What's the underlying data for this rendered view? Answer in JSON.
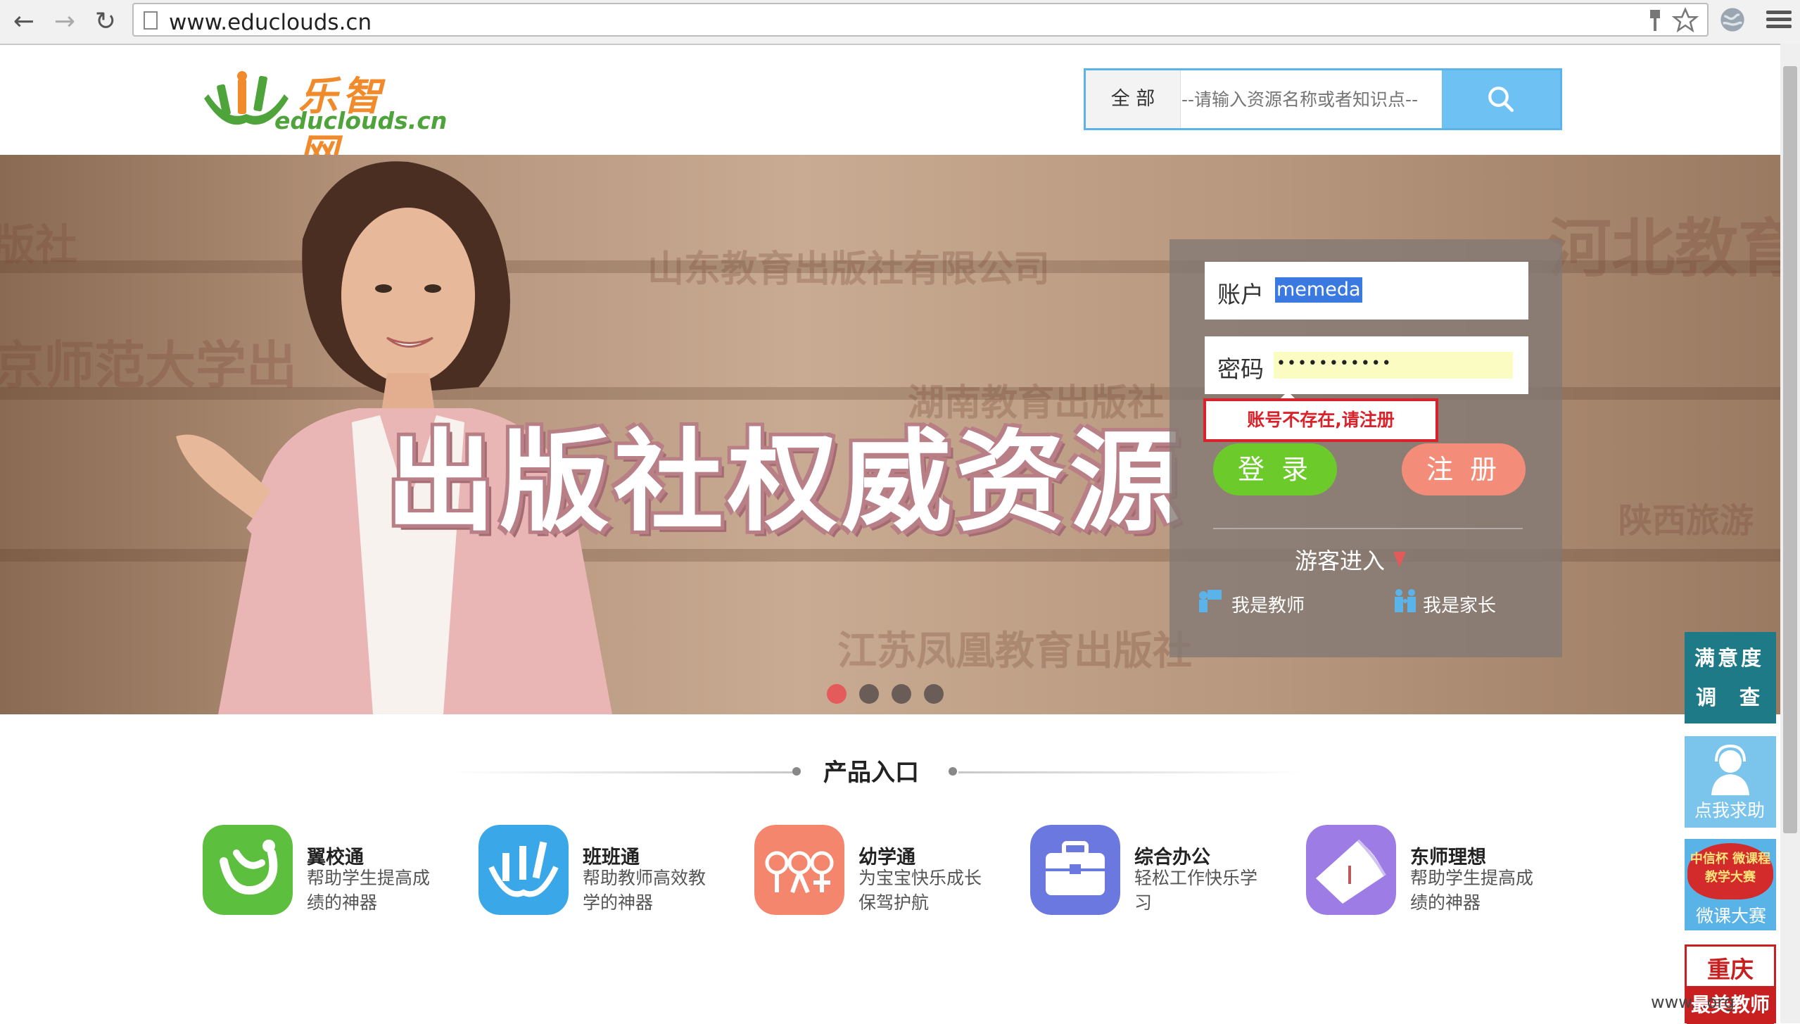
{
  "browser": {
    "url": "www.educlouds.cn",
    "back_icon": "←",
    "forward_icon": "→",
    "reload_icon": "↻"
  },
  "header": {
    "logo_name": "乐智网",
    "logo_domain": "educlouds.cn",
    "search_scope": "全 部",
    "search_placeholder": "--请输入资源名称或者知识点--"
  },
  "banner": {
    "headline": "出版社权威资源",
    "watermarks": [
      "山东教育出版社有限公司",
      "京师范大学出",
      "河北教育",
      "版社",
      "湖南教育出版社",
      "陕西旅游",
      "江苏凤凰教育出版社"
    ],
    "slide_count": 4,
    "active_slide": 0
  },
  "login": {
    "account_label": "账户",
    "account_value": "memeda",
    "password_label": "密码",
    "password_mask": "•••••••••••",
    "error_message": "账号不存在,请注册",
    "login_button": "登 录",
    "register_button": "注 册",
    "guest_label": "游客进入",
    "teacher_link": "我是教师",
    "parent_link": "我是家长"
  },
  "products": {
    "section_title": "产品入口",
    "items": [
      {
        "name": "翼校通",
        "desc": "帮助学生提高成绩的神器",
        "color": "#5cbf3e"
      },
      {
        "name": "班班通",
        "desc": "帮助教师高效教学的神器",
        "color": "#3aa8e8"
      },
      {
        "name": "幼学通",
        "desc": "为宝宝快乐成长保驾护航",
        "color": "#f4866d"
      },
      {
        "name": "综合办公",
        "desc": "轻松工作快乐学习",
        "color": "#6b78e0"
      },
      {
        "name": "东师理想",
        "desc": "帮助学生提高成绩的神器",
        "color": "#9d7ce6"
      }
    ]
  },
  "sidebar": {
    "survey_line1": "满意度",
    "survey_line2a": "调",
    "survey_line2b": "查",
    "help_label": "点我求助",
    "weike_badge": "中信杯 微课程教学大赛",
    "weike_label": "微课大赛",
    "cq_title": "重庆",
    "cq_sub": "最美教师"
  },
  "watermark_text": "www.        .org"
}
